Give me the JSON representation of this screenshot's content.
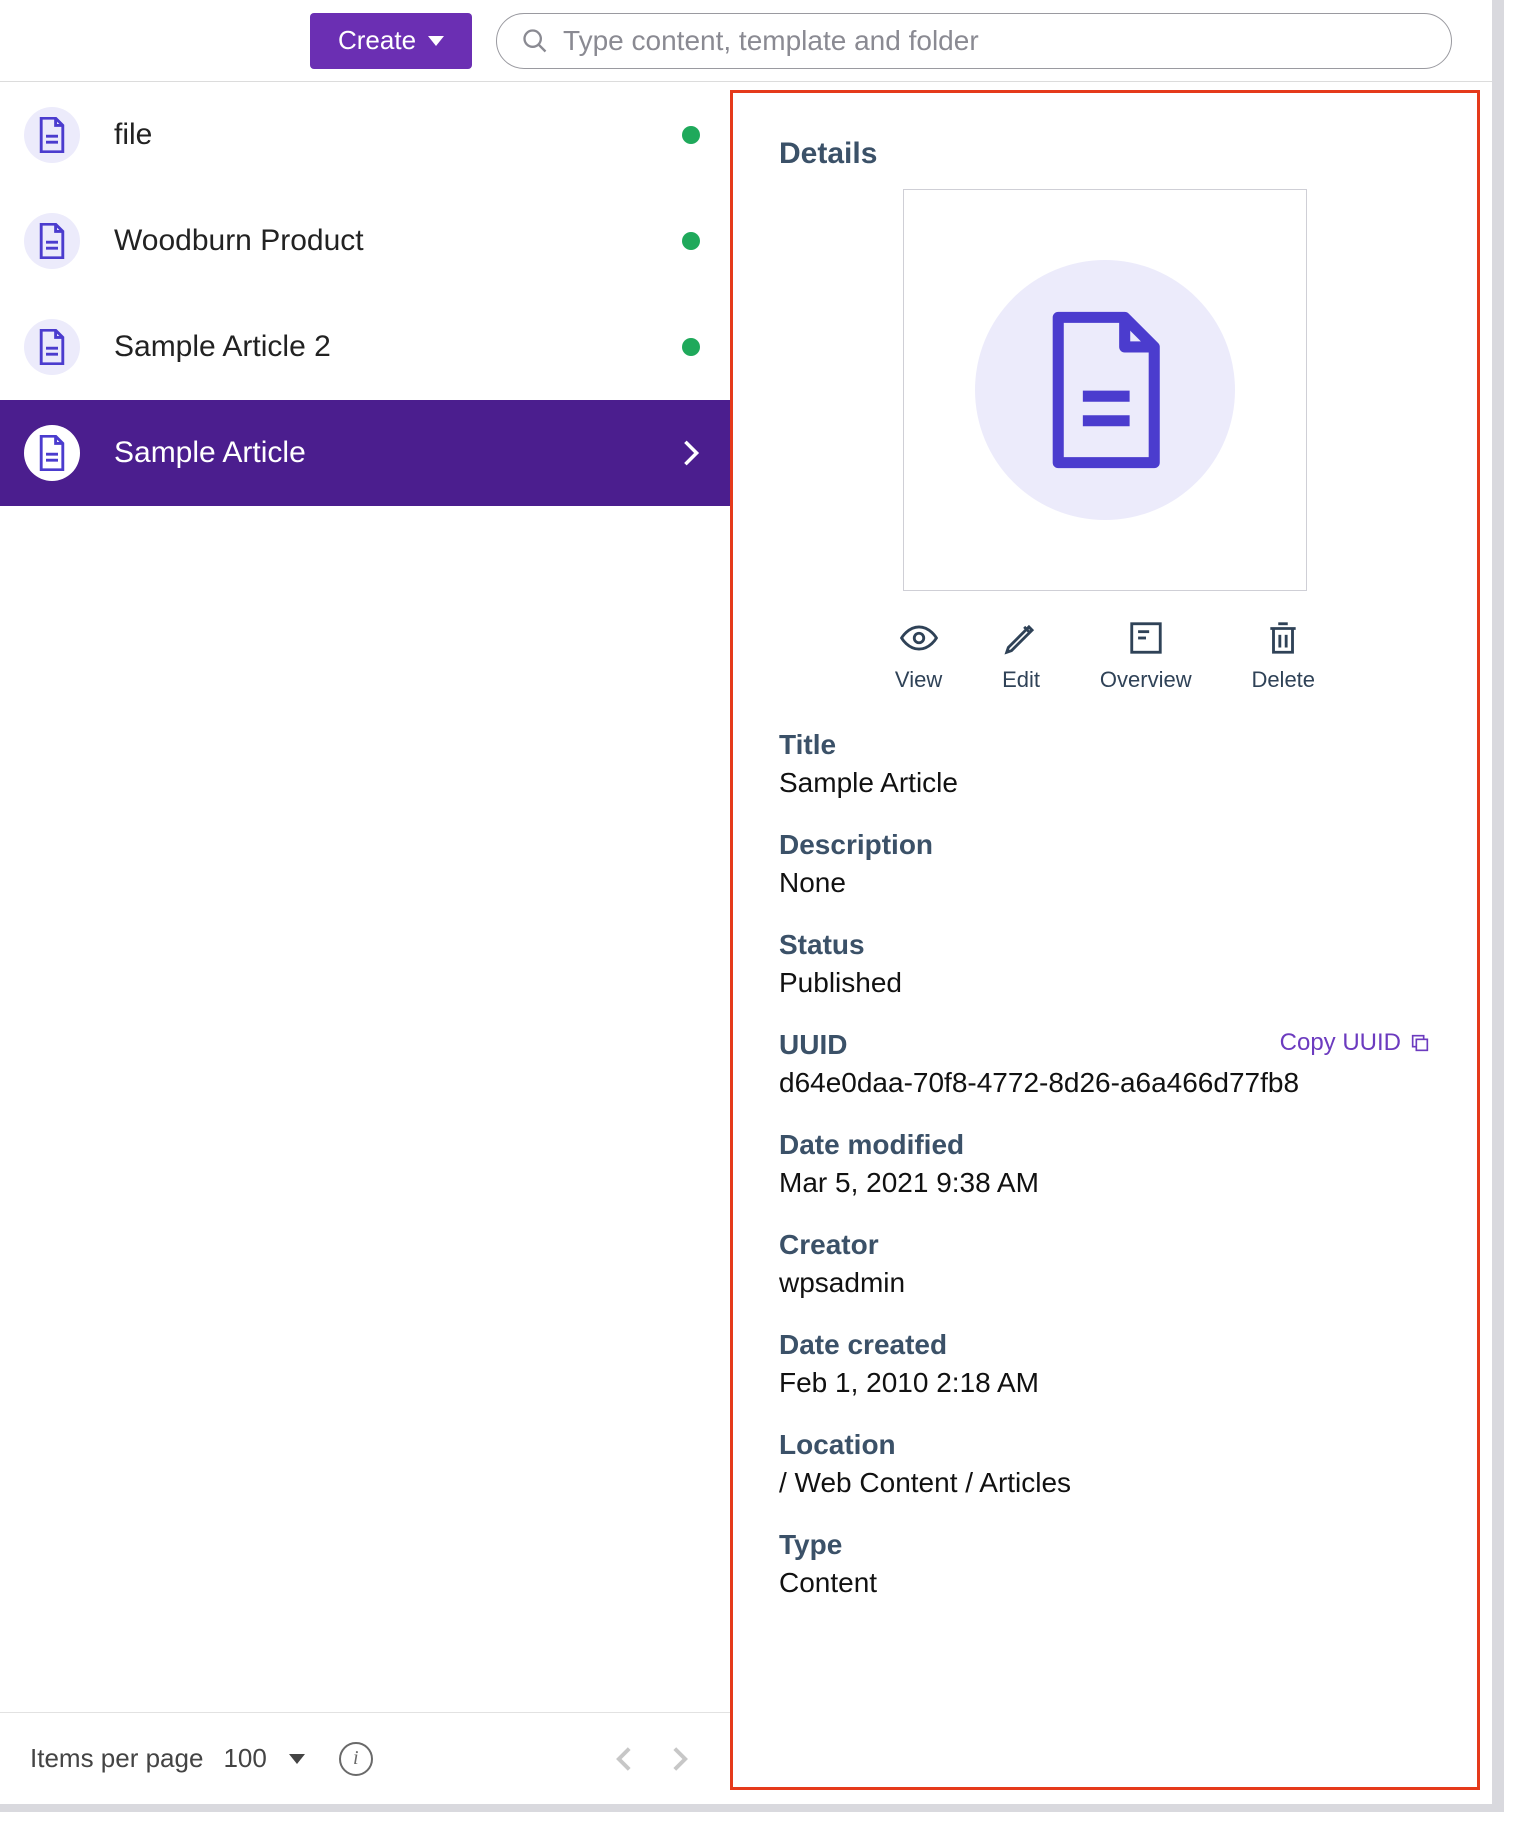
{
  "topbar": {
    "create_label": "Create",
    "search_placeholder": "Type content, template and folder"
  },
  "list": {
    "items": [
      {
        "label": "file",
        "status": "published",
        "selected": false
      },
      {
        "label": "Woodburn Product",
        "status": "published",
        "selected": false
      },
      {
        "label": "Sample Article 2",
        "status": "published",
        "selected": false
      },
      {
        "label": "Sample Article",
        "status": "published",
        "selected": true
      }
    ]
  },
  "pager": {
    "items_per_page_label": "Items per page",
    "per_page_value": "100"
  },
  "details": {
    "heading": "Details",
    "actions": {
      "view": "View",
      "edit": "Edit",
      "overview": "Overview",
      "delete": "Delete"
    },
    "copy_uuid_label": "Copy UUID",
    "fields": {
      "title": {
        "label": "Title",
        "value": "Sample Article"
      },
      "description": {
        "label": "Description",
        "value": "None"
      },
      "status": {
        "label": "Status",
        "value": "Published"
      },
      "uuid": {
        "label": "UUID",
        "value": "d64e0daa-70f8-4772-8d26-a6a466d77fb8"
      },
      "date_modified": {
        "label": "Date modified",
        "value": "Mar 5, 2021 9:38 AM"
      },
      "creator": {
        "label": "Creator",
        "value": "wpsadmin"
      },
      "date_created": {
        "label": "Date created",
        "value": "Feb 1, 2010 2:18 AM"
      },
      "location": {
        "label": "Location",
        "value": "/ Web Content / Articles"
      },
      "type": {
        "label": "Type",
        "value": "Content"
      }
    }
  }
}
